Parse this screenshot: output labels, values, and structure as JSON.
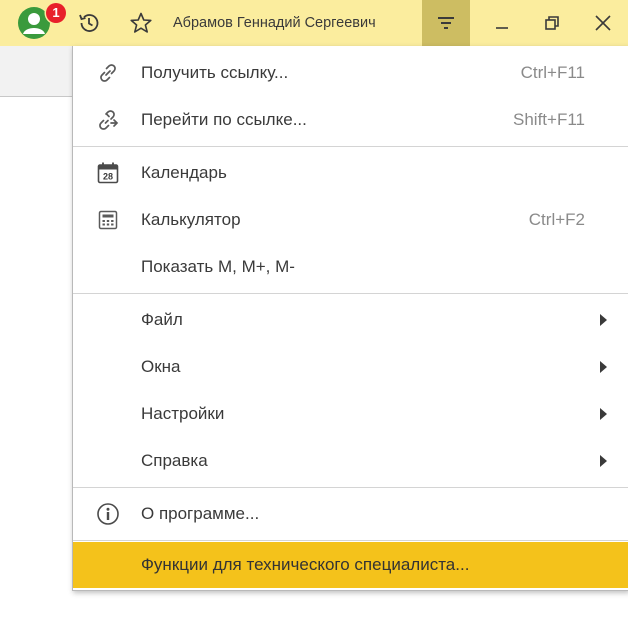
{
  "titlebar": {
    "notification_count": "1",
    "user_name": "Абрамов Геннадий Сергеевич",
    "icons": {
      "avatar": "user-avatar-icon",
      "history": "history-icon",
      "favorites": "star-icon",
      "menu": "main-menu-icon",
      "minimize": "minimize-icon",
      "maximize": "restore-icon",
      "close": "close-icon"
    }
  },
  "menu": {
    "items": [
      {
        "label": "Получить ссылку...",
        "shortcut": "Ctrl+F11",
        "icon": "link-icon"
      },
      {
        "label": "Перейти по ссылке...",
        "shortcut": "Shift+F11",
        "icon": "go-to-link-icon"
      },
      {
        "label": "Календарь",
        "shortcut": "",
        "icon": "calendar-icon",
        "calendar_day": "28"
      },
      {
        "label": "Калькулятор",
        "shortcut": "Ctrl+F2",
        "icon": "calculator-icon"
      },
      {
        "label": "Показать M, M+, M-",
        "shortcut": ""
      },
      {
        "label": "Файл",
        "submenu": true
      },
      {
        "label": "Окна",
        "submenu": true
      },
      {
        "label": "Настройки",
        "submenu": true
      },
      {
        "label": "Справка",
        "submenu": true
      },
      {
        "label": "О программе...",
        "shortcut": "",
        "icon": "info-icon"
      },
      {
        "label": "Функции для технического специалиста...",
        "shortcut": "",
        "highlighted": true
      }
    ]
  },
  "colors": {
    "titlebar_bg": "#fbed9e",
    "menu_button_active_bg": "#cdbd62",
    "highlight_bg": "#f4c21b",
    "badge_bg": "#e8202a",
    "avatar_green": "#3a9a3c"
  }
}
